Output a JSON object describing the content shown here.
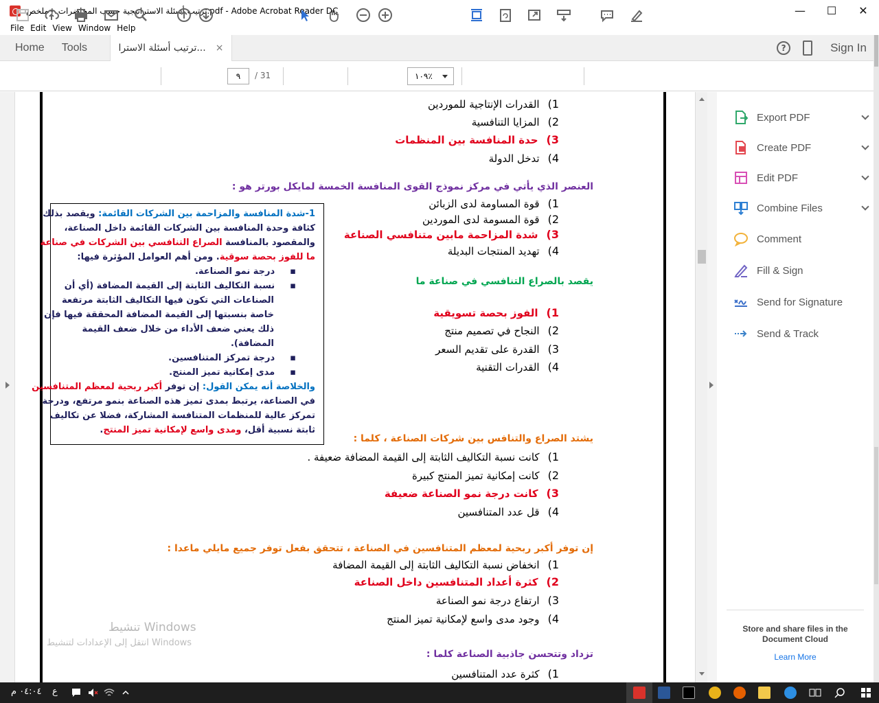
{
  "window": {
    "title": "ترتيب أسئلة الاستراتيجية حسب المحاضرات +ملخص.pdf - Adobe Acrobat Reader DC",
    "minimize": "—",
    "maximize": "☐",
    "close": "✕"
  },
  "menu": [
    "File",
    "Edit",
    "View",
    "Window",
    "Help"
  ],
  "tabs": {
    "home": "Home",
    "tools": "Tools",
    "doc": "ترتيب أسئلة الاسترا...",
    "close": "×",
    "help": "?",
    "signin": "Sign In"
  },
  "toolbar": {
    "page_current": "٩",
    "page_total": "/ 31",
    "zoom": "١٠٩٪"
  },
  "document": {
    "q1_options": [
      {
        "n": "1)",
        "text": "القدرات الإنتاجية للموردين",
        "correct": false
      },
      {
        "n": "2)",
        "text": "المزايا التنافسية",
        "correct": false
      },
      {
        "n": "3)",
        "text": "حدة المنافسة بين المنظمات",
        "correct": true
      },
      {
        "n": "4)",
        "text": "تدخل الدولة",
        "correct": false
      }
    ],
    "q2_title": "العنصر الذي يأتي في مركز نموذج القوى المنافسة الخمسة لمايكل بورتر هو :",
    "q2_options": [
      {
        "n": "1)",
        "text": "قوة المساومة لدى الزبائن",
        "correct": false
      },
      {
        "n": "2)",
        "text": "قوة المسومة لدى الموردين",
        "correct": false
      },
      {
        "n": "3)",
        "text": "شدة المزاحمة مابين متنافسي الصناعة",
        "correct": true
      },
      {
        "n": "4)",
        "text": "تهديد المنتجات البديلة",
        "correct": false
      }
    ],
    "q3_title": "يقصد بالصراع التنافسي في صناعة ما",
    "q3_options": [
      {
        "n": "1)",
        "text": "الفوز بحصة تسويقية",
        "correct": true
      },
      {
        "n": "2)",
        "text": "النجاح في تصميم منتج",
        "correct": false
      },
      {
        "n": "3)",
        "text": "القدرة على تقديم السعر",
        "correct": false
      },
      {
        "n": "4)",
        "text": "القدرات التقنية",
        "correct": false
      }
    ],
    "q4_title": "يشتد الصراع والتنافس بين شركات الصناعة ، كلما :",
    "q4_options": [
      {
        "n": "1)",
        "text": "كانت نسبة التكاليف الثابتة إلى القيمة المضافة ضعيفة .",
        "correct": false
      },
      {
        "n": "2)",
        "text": "كانت إمكانية تميز المنتج كبيرة",
        "correct": false
      },
      {
        "n": "3)",
        "text": "كانت درجة نمو الصناعة ضعيفة",
        "correct": true
      },
      {
        "n": "4)",
        "text": "قل عدد المتنافسين",
        "correct": false
      }
    ],
    "q5_title": "إن توفر أكبر ربحية لمعظم المتنافسين في الصناعة ، تتحقق بفعل توفر جميع مايلي ماعدا :",
    "q5_options": [
      {
        "n": "1)",
        "text": "انخفاض نسبة التكاليف الثابتة إلى القيمة المضافة",
        "correct": false
      },
      {
        "n": "2)",
        "text": "كثرة أعداد المتنافسين داخل الصناعة",
        "correct": true
      },
      {
        "n": "3)",
        "text": "ارتفاع درجة نمو الصناعة",
        "correct": false
      },
      {
        "n": "4)",
        "text": "وجود مدى واسع لإمكانية تميز المنتج",
        "correct": false
      }
    ],
    "q6_title": "تزداد وتتحسن جاذبية الصناعة كلما :",
    "q6_first": {
      "n": "1)",
      "text": "كثرة عدد المتنافسين"
    },
    "note": {
      "l1a": "1-شدة المنافسة والمزاحمة بين الشركات القائمة:",
      "l1b": " ويقصد بذلك",
      "l2": "كثافة وحدة المنافسة بين الشركات القائمة داخل الصناعة،",
      "l3a": "والمقصود بالمنافسة ",
      "l3b": "الصراع التنافسي بين الشركات في صناعة",
      "l4a": "ما للفوز بحصة سوقية",
      "l4b": ". ومن أهم العوامل المؤثرة فيها:",
      "b1": "درجة نمو الصناعة.",
      "b2": "نسبة التكاليف الثابتة إلى القيمة المضافة (أي أن",
      "b2c1": "الصناعات التي تكون فيها التكاليف الثابتة مرتفعة",
      "b2c2": "خاصة بنسبتها إلى القيمة المضافة المحققة فيها فإن",
      "b2c3": "ذلك يعني  ضعف الأداء من خلال ضعف القيمة",
      "b2c4": "المضافة).",
      "b3": "درجة تمركز المتنافسين.",
      "b4": "مدى إمكانية تميز المنتج.",
      "s1a": "والخلاصة أنه يمكن القول:",
      "s1b": " إن توفر ",
      "s1c": "أكبر ربحية لمعظم المتنافسين",
      "s2": "في الصناعة، يرتبط بمدى تميز هذه الصناعة بنمو مرتفع، ودرجة",
      "s3": "تمركز عالية للمنظمات المتنافسة المشاركة، فضلا عن تكاليف",
      "s4a": "ثابتة نسبية أقل، ",
      "s4b": "ومدى واسع لإمكانية تميز المنتج",
      "s4c": ".",
      "bullet": "▪"
    },
    "watermark_title": "تنشيط Windows",
    "watermark_sub": "انتقل إلى الإعدادات لتنشيط Windows"
  },
  "right_panel": {
    "items": [
      {
        "label": "Export PDF",
        "icon": "export-pdf-icon",
        "color": "#2fa86b",
        "chevron": true
      },
      {
        "label": "Create PDF",
        "icon": "create-pdf-icon",
        "color": "#e34850",
        "chevron": true
      },
      {
        "label": "Edit PDF",
        "icon": "edit-pdf-icon",
        "color": "#d84fb5",
        "chevron": true
      },
      {
        "label": "Combine Files",
        "icon": "combine-files-icon",
        "color": "#2d7fd3",
        "chevron": true
      },
      {
        "label": "Comment",
        "icon": "comment-icon",
        "color": "#f2b23a",
        "chevron": false
      },
      {
        "label": "Fill & Sign",
        "icon": "fill-sign-icon",
        "color": "#7063c4",
        "chevron": false
      },
      {
        "label": "Send for Signature",
        "icon": "send-signature-icon",
        "color": "#3b6fc9",
        "chevron": false
      },
      {
        "label": "Send & Track",
        "icon": "send-track-icon",
        "color": "#3b82c9",
        "chevron": false
      }
    ],
    "cloud_text": "Store and share files in the Document Cloud",
    "learn_more": "Learn More"
  },
  "taskbar": {
    "time": "٠٤:٠٤ م",
    "lang": "ع"
  }
}
